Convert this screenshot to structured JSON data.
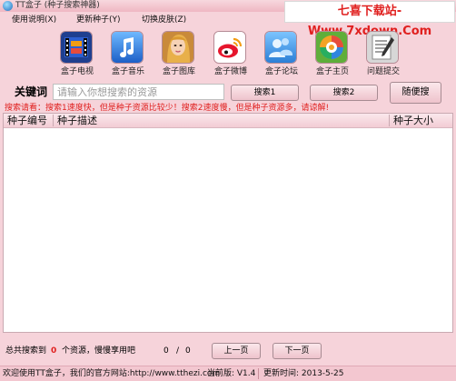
{
  "window": {
    "title": "TT盒子 (种子搜索神器)"
  },
  "watermark": "七喜下载站-Www.7xdown.Com",
  "menu": [
    "使用说明(X)",
    "更新种子(Y)",
    "切换皮肤(Z)"
  ],
  "toolbar": [
    {
      "label": "盒子电视",
      "icon": "film-icon"
    },
    {
      "label": "盒子音乐",
      "icon": "music-note-icon"
    },
    {
      "label": "盒子图库",
      "icon": "portrait-icon"
    },
    {
      "label": "盒子微博",
      "icon": "weibo-icon"
    },
    {
      "label": "盒子论坛",
      "icon": "forum-users-icon"
    },
    {
      "label": "盒子主页",
      "icon": "home-swirl-icon"
    },
    {
      "label": "问题提交",
      "icon": "notepad-pen-icon"
    }
  ],
  "search": {
    "keyword_label": "关键词",
    "placeholder": "请输入你想搜索的资源",
    "btn1": "搜索1",
    "btn2": "搜索2",
    "random": "随便搜"
  },
  "tip": "搜索请看：搜索1速度快，但是种子资源比较少！搜索2速度慢，但是种子资源多，请谅解!",
  "columns": [
    "种子编号",
    "种子描述",
    "种子大小"
  ],
  "status": {
    "prefix": "总共搜索到",
    "count": "0",
    "suffix": "个资源，慢慢享用吧",
    "page_current": "0",
    "page_sep": "/",
    "page_total": "0",
    "prev": "上一页",
    "next": "下一页"
  },
  "footer": {
    "welcome": "欢迎使用TT盒子，我们的官方网站:http://www.tthezi.com",
    "version": "当前版: V1.4",
    "updated": "更新时间: 2013-5-25"
  },
  "colors": {
    "accent_red": "#e0201f",
    "window_pink": "#f6d3da"
  }
}
